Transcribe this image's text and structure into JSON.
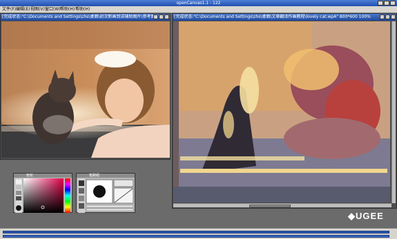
{
  "app": {
    "title": "openCanvas1.1 - 122"
  },
  "menu": [
    "文件(F)",
    "编辑(E)",
    "视图(V)",
    "窗口(W)",
    "帮助(H)",
    "帮助(H)"
  ],
  "left_doc": {
    "title": "[完成状态:\"C:\\Documents and Settings\\zhs\\桌面\\初次新画到讲辅助图片\\参考图片\\G5..."
  },
  "right_doc": {
    "title": "[完成状态:\"C:\\Documents and Settings\\zhs\\桌面\\文章翻译作画教程\\lovely cat.wpA\" 800*600 100%"
  },
  "color_panel": {
    "title": "色轮"
  },
  "brush_panel": {
    "title": "笔刷组"
  },
  "brand": {
    "name": "UGEE"
  },
  "colors": {
    "titlebar": "#2d5ec2",
    "workspace": "#6b6b6b",
    "menubar": "#d9d6cf"
  }
}
